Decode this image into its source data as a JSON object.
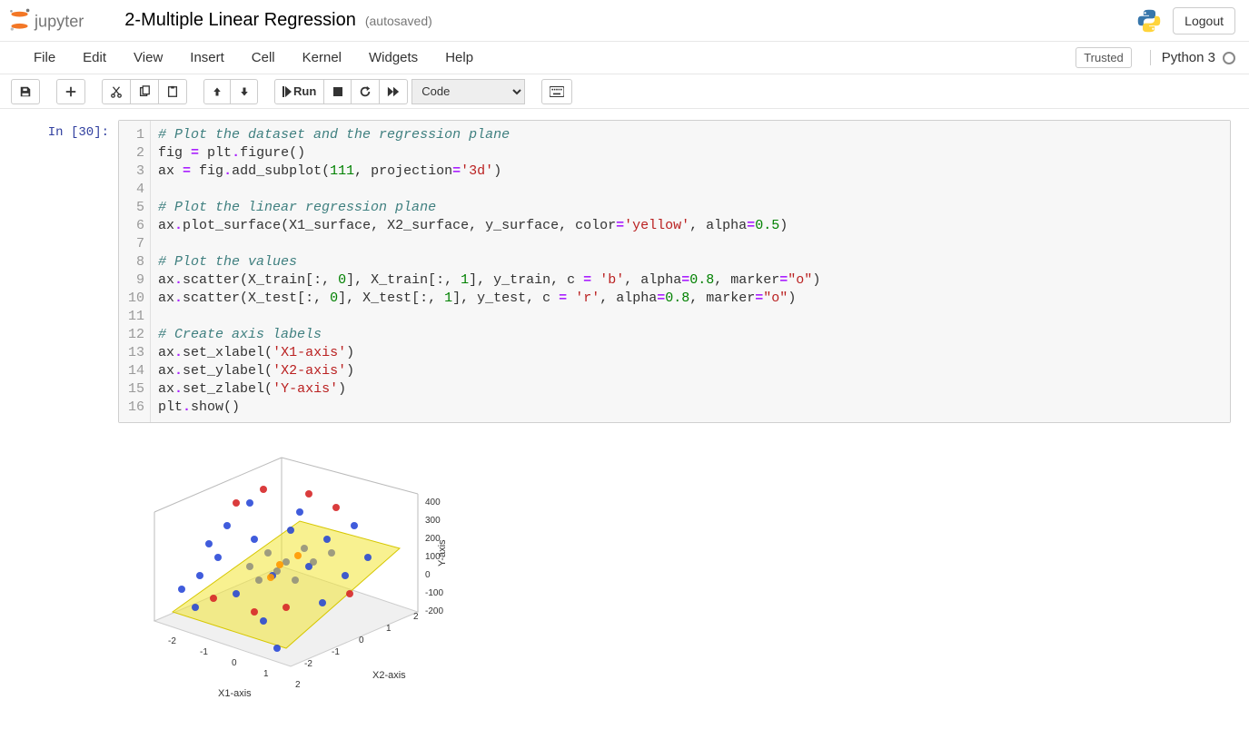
{
  "header": {
    "logo_label": "Jupyter",
    "notebook_name": "2-Multiple Linear Regression",
    "autosave_status": "(autosaved)",
    "logout_label": "Logout"
  },
  "menubar": {
    "items": [
      "File",
      "Edit",
      "View",
      "Insert",
      "Cell",
      "Kernel",
      "Widgets",
      "Help"
    ],
    "trusted_label": "Trusted",
    "kernel_name": "Python 3"
  },
  "toolbar": {
    "run_label": "Run",
    "celltype_selected": "Code"
  },
  "cell": {
    "prompt": "In [30]:",
    "code_lines": [
      {
        "n": 1,
        "t": [
          {
            "c": "com",
            "v": "# Plot the dataset and the regression plane"
          }
        ]
      },
      {
        "n": 2,
        "t": [
          {
            "v": "fig "
          },
          {
            "c": "op",
            "v": "="
          },
          {
            "v": " plt"
          },
          {
            "c": "op",
            "v": "."
          },
          {
            "v": "figure()"
          }
        ]
      },
      {
        "n": 3,
        "t": [
          {
            "v": "ax "
          },
          {
            "c": "op",
            "v": "="
          },
          {
            "v": " fig"
          },
          {
            "c": "op",
            "v": "."
          },
          {
            "v": "add_subplot("
          },
          {
            "c": "num",
            "v": "111"
          },
          {
            "v": ", projection"
          },
          {
            "c": "op",
            "v": "="
          },
          {
            "c": "str",
            "v": "'3d'"
          },
          {
            "v": ")"
          }
        ]
      },
      {
        "n": 4,
        "t": [
          {
            "v": ""
          }
        ]
      },
      {
        "n": 5,
        "t": [
          {
            "c": "com",
            "v": "# Plot the linear regression plane"
          }
        ]
      },
      {
        "n": 6,
        "t": [
          {
            "v": "ax"
          },
          {
            "c": "op",
            "v": "."
          },
          {
            "v": "plot_surface(X1_surface, X2_surface, y_surface, color"
          },
          {
            "c": "op",
            "v": "="
          },
          {
            "c": "str",
            "v": "'yellow'"
          },
          {
            "v": ", alpha"
          },
          {
            "c": "op",
            "v": "="
          },
          {
            "c": "num",
            "v": "0.5"
          },
          {
            "v": ")"
          }
        ]
      },
      {
        "n": 7,
        "t": [
          {
            "v": ""
          }
        ]
      },
      {
        "n": 8,
        "t": [
          {
            "c": "com",
            "v": "# Plot the values"
          }
        ]
      },
      {
        "n": 9,
        "t": [
          {
            "v": "ax"
          },
          {
            "c": "op",
            "v": "."
          },
          {
            "v": "scatter(X_train[:, "
          },
          {
            "c": "num",
            "v": "0"
          },
          {
            "v": "], X_train[:, "
          },
          {
            "c": "num",
            "v": "1"
          },
          {
            "v": "], y_train, c "
          },
          {
            "c": "op",
            "v": "="
          },
          {
            "v": " "
          },
          {
            "c": "str",
            "v": "'b'"
          },
          {
            "v": ", alpha"
          },
          {
            "c": "op",
            "v": "="
          },
          {
            "c": "num",
            "v": "0.8"
          },
          {
            "v": ", marker"
          },
          {
            "c": "op",
            "v": "="
          },
          {
            "c": "str",
            "v": "\"o\""
          },
          {
            "v": ")"
          }
        ]
      },
      {
        "n": 10,
        "t": [
          {
            "v": "ax"
          },
          {
            "c": "op",
            "v": "."
          },
          {
            "v": "scatter(X_test[:, "
          },
          {
            "c": "num",
            "v": "0"
          },
          {
            "v": "], X_test[:, "
          },
          {
            "c": "num",
            "v": "1"
          },
          {
            "v": "], y_test, c "
          },
          {
            "c": "op",
            "v": "="
          },
          {
            "v": " "
          },
          {
            "c": "str",
            "v": "'r'"
          },
          {
            "v": ", alpha"
          },
          {
            "c": "op",
            "v": "="
          },
          {
            "c": "num",
            "v": "0.8"
          },
          {
            "v": ", marker"
          },
          {
            "c": "op",
            "v": "="
          },
          {
            "c": "str",
            "v": "\"o\""
          },
          {
            "v": ")"
          }
        ]
      },
      {
        "n": 11,
        "t": [
          {
            "v": ""
          }
        ]
      },
      {
        "n": 12,
        "t": [
          {
            "c": "com",
            "v": "# Create axis labels"
          }
        ]
      },
      {
        "n": 13,
        "t": [
          {
            "v": "ax"
          },
          {
            "c": "op",
            "v": "."
          },
          {
            "v": "set_xlabel("
          },
          {
            "c": "str",
            "v": "'X1-axis'"
          },
          {
            "v": ")"
          }
        ]
      },
      {
        "n": 14,
        "t": [
          {
            "v": "ax"
          },
          {
            "c": "op",
            "v": "."
          },
          {
            "v": "set_ylabel("
          },
          {
            "c": "str",
            "v": "'X2-axis'"
          },
          {
            "v": ")"
          }
        ]
      },
      {
        "n": 15,
        "t": [
          {
            "v": "ax"
          },
          {
            "c": "op",
            "v": "."
          },
          {
            "v": "set_zlabel("
          },
          {
            "c": "str",
            "v": "'Y-axis'"
          },
          {
            "v": ")"
          }
        ]
      },
      {
        "n": 16,
        "t": [
          {
            "v": "plt"
          },
          {
            "c": "op",
            "v": "."
          },
          {
            "v": "show()"
          }
        ]
      }
    ]
  },
  "chart_data": {
    "type": "3d-scatter-with-surface",
    "x1_label": "X1-axis",
    "x2_label": "X2-axis",
    "y_label": "Y-axis",
    "x1_ticks": [
      -2,
      -1,
      0,
      1,
      2
    ],
    "x2_ticks": [
      -2,
      -1,
      0,
      1,
      2
    ],
    "y_ticks": [
      -200,
      -100,
      0,
      100,
      200,
      300,
      400
    ],
    "surface": {
      "color": "yellow",
      "alpha": 0.5
    },
    "series": [
      {
        "name": "train",
        "color": "b",
        "alpha": 0.8,
        "marker": "o"
      },
      {
        "name": "test",
        "color": "r",
        "alpha": 0.8,
        "marker": "o"
      }
    ],
    "note": "exact point coordinates not labeled in image"
  }
}
